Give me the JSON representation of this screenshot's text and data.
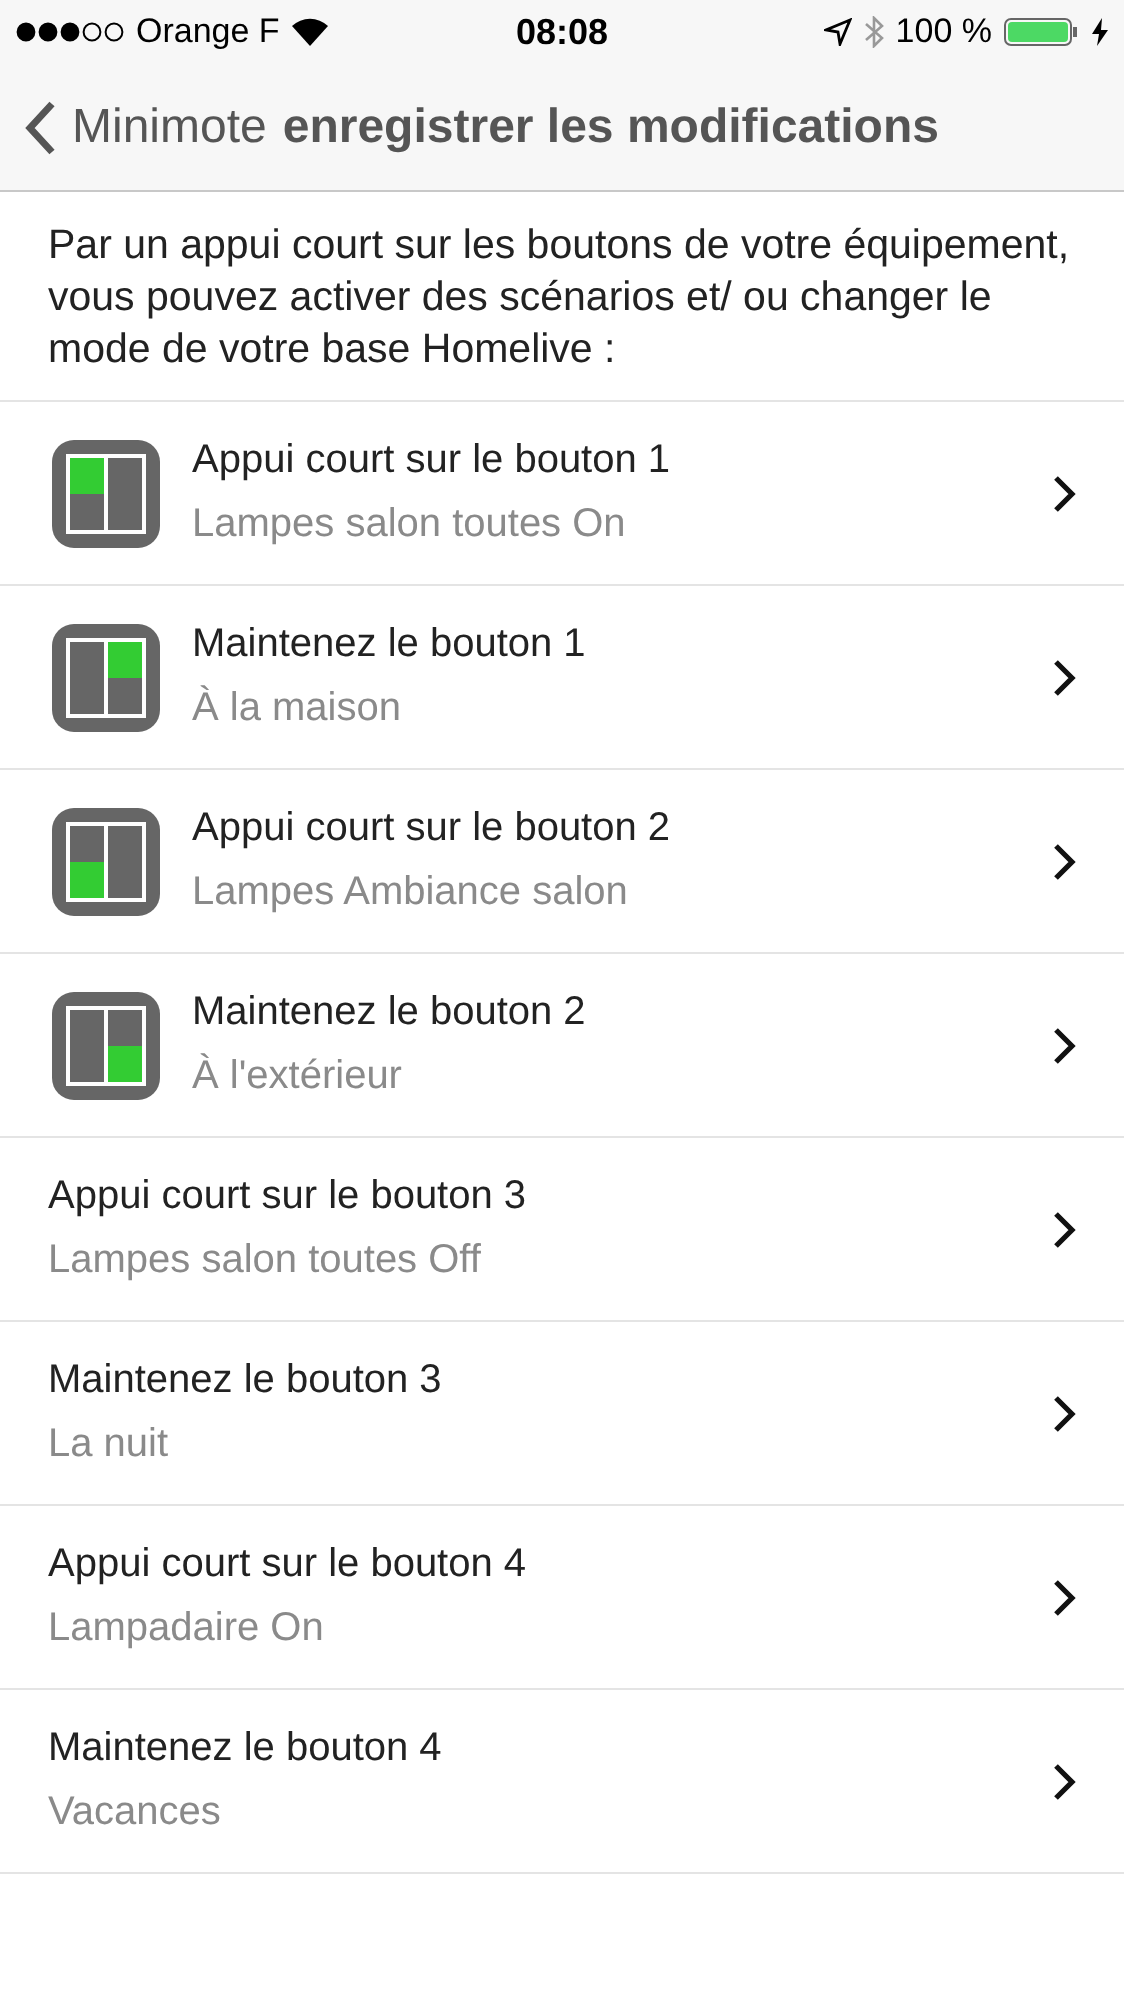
{
  "status_bar": {
    "carrier": "Orange F",
    "time": "08:08",
    "battery": "100 %"
  },
  "nav": {
    "back": "Minimote",
    "title": "enregistrer les modifications"
  },
  "intro": "Par un appui court sur les boutons de votre équipement, vous pouvez activer des scénarios et/ ou changer le mode de votre base Homelive :",
  "rows": [
    {
      "title": "Appui court sur le bouton 1",
      "subtitle": "Lampes salon toutes On",
      "quadrants": [
        {
          "selected": true
        },
        {
          "selected": false
        },
        {
          "selected": false
        },
        {
          "selected": false
        }
      ]
    },
    {
      "title": "Maintenez le bouton 1",
      "subtitle": "À la maison",
      "quadrants": [
        {
          "selected": false
        },
        {
          "selected": true
        },
        {
          "selected": false
        },
        {
          "selected": false
        }
      ]
    },
    {
      "title": "Appui court sur le bouton 2",
      "subtitle": "Lampes Ambiance salon",
      "quadrants": [
        {
          "selected": false
        },
        {
          "selected": false
        },
        {
          "selected": true
        },
        {
          "selected": false
        }
      ]
    },
    {
      "title": "Maintenez le bouton 2",
      "subtitle": "À l'extérieur",
      "quadrants": [
        {
          "selected": false
        },
        {
          "selected": false
        },
        {
          "selected": false
        },
        {
          "selected": true
        }
      ]
    },
    {
      "title": "Appui court sur le bouton 3",
      "subtitle": "Lampes salon toutes Off"
    },
    {
      "title": "Maintenez le bouton 3",
      "subtitle": "La nuit"
    },
    {
      "title": "Appui court sur le bouton 4",
      "subtitle": "Lampadaire On"
    },
    {
      "title": "Maintenez le bouton 4",
      "subtitle": "Vacances"
    }
  ]
}
